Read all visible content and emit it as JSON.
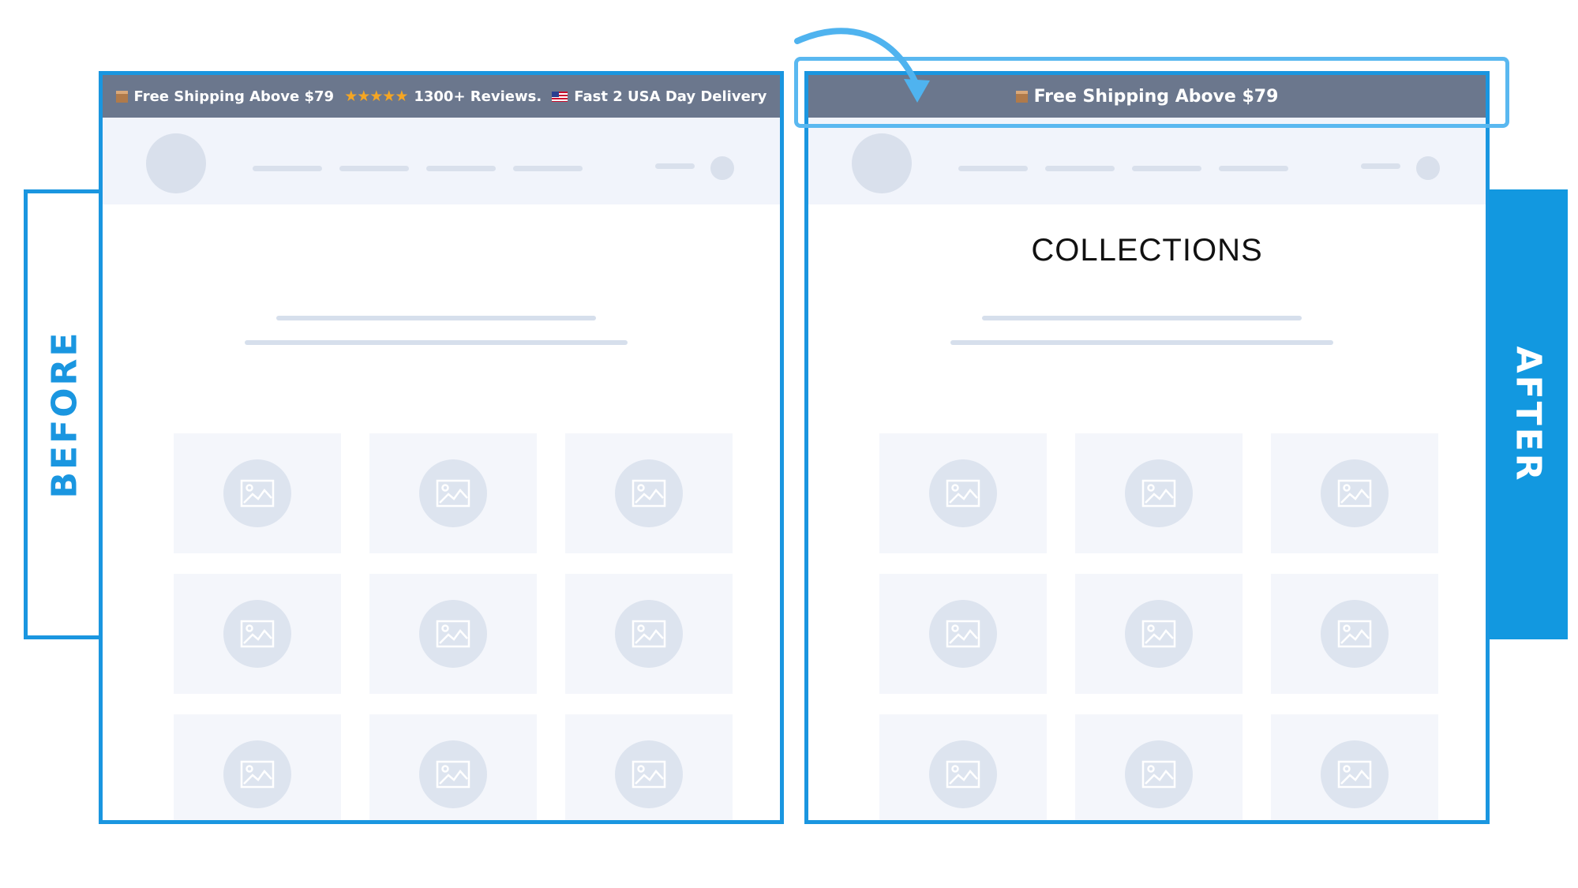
{
  "labels": {
    "before": "BEFORE",
    "after": "AFTER"
  },
  "before": {
    "announcement": {
      "shipping": "Free Shipping Above $79",
      "stars": "★★★★★",
      "reviews": "1300+ Reviews.",
      "delivery": "Fast 2 USA Day Delivery"
    }
  },
  "after": {
    "announcement": {
      "shipping": "Free Shipping Above $79"
    },
    "page_heading": "COLLECTIONS"
  },
  "icons": {
    "announcement": [
      "package-icon",
      "star-rating-icon",
      "us-flag-icon"
    ],
    "placeholder": "image-placeholder-icon",
    "pointer": "curved-arrow-icon"
  },
  "colors": {
    "accent": "#1a96e0",
    "after_tab": "#1298e0",
    "highlight": "#5ab8f0",
    "announcement_bar": "#6b778d",
    "placeholder": "#dde4ef"
  }
}
